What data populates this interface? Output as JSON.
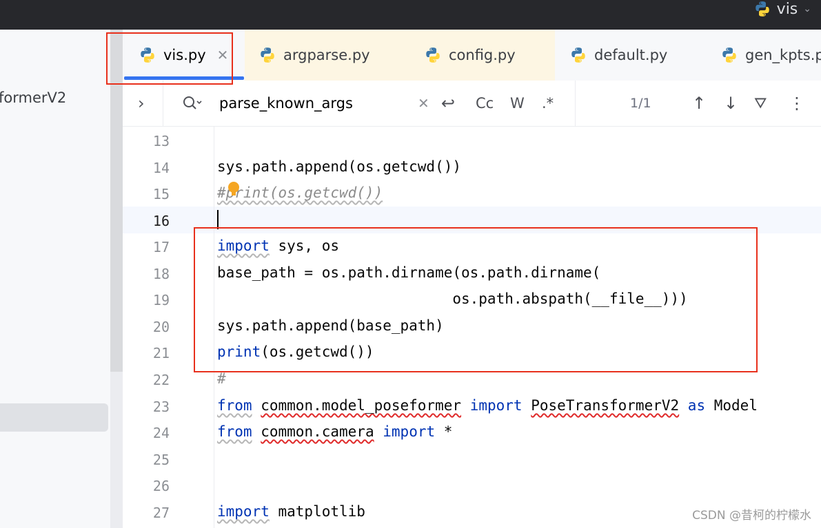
{
  "header": {
    "project_name": "vis",
    "project_chevron": "⌄"
  },
  "left_panel": {
    "truncated_item": "formerV2"
  },
  "tabs": [
    {
      "label": "vis.py",
      "active": true,
      "closable": true,
      "close_glyph": "✕"
    },
    {
      "label": "argparse.py",
      "active": false
    },
    {
      "label": "config.py",
      "active": false
    },
    {
      "label": "default.py",
      "active": false
    },
    {
      "label": "gen_kpts.p",
      "active": false
    }
  ],
  "search": {
    "expand_glyph": "›",
    "query": "parse_known_args",
    "clear_glyph": "✕",
    "replace_glyph": "↩",
    "match_case": "Cc",
    "whole_words": "W",
    "regex": ".*",
    "match_count": "1/1",
    "prev_glyph": "↑",
    "next_glyph": "↓",
    "filter_glyph": "⛛",
    "more_glyph": "⋮"
  },
  "editor": {
    "line_numbers": [
      "13",
      "14",
      "15",
      "16",
      "17",
      "18",
      "19",
      "20",
      "21",
      "22",
      "23",
      "24",
      "25",
      "26",
      "27"
    ],
    "current_line": "16",
    "lines": {
      "l14": "sys.path.append(os.getcwd())",
      "l15": "#print(os.getcwd())",
      "l17_kw": "import",
      "l17_rest": " sys, os",
      "l18": "base_path = os.path.dirname(os.path.dirname(",
      "l19": "                           os.path.abspath(__file__)))",
      "l20": "sys.path.append(base_path)",
      "l21_kw": "print",
      "l21_rest": "(os.getcwd())",
      "l22": "#",
      "l23_kw1": "from",
      "l23_mod": "common.model_poseformer",
      "l23_kw2": "import",
      "l23_name": "PoseTransformerV2",
      "l23_kw3": "as",
      "l23_alias": "Model",
      "l24_kw1": "from",
      "l24_mod": "common.camera",
      "l24_kw2": "import",
      "l24_rest": " *",
      "l27_kw": "import",
      "l27_rest": " matplotlib"
    }
  },
  "watermark": "CSDN @昔柯的柠檬水",
  "colors": {
    "keyword": "#0033b3",
    "comment": "#8c8c8c",
    "highlight_box": "#e8301c",
    "tab_underline": "#3574f0"
  }
}
